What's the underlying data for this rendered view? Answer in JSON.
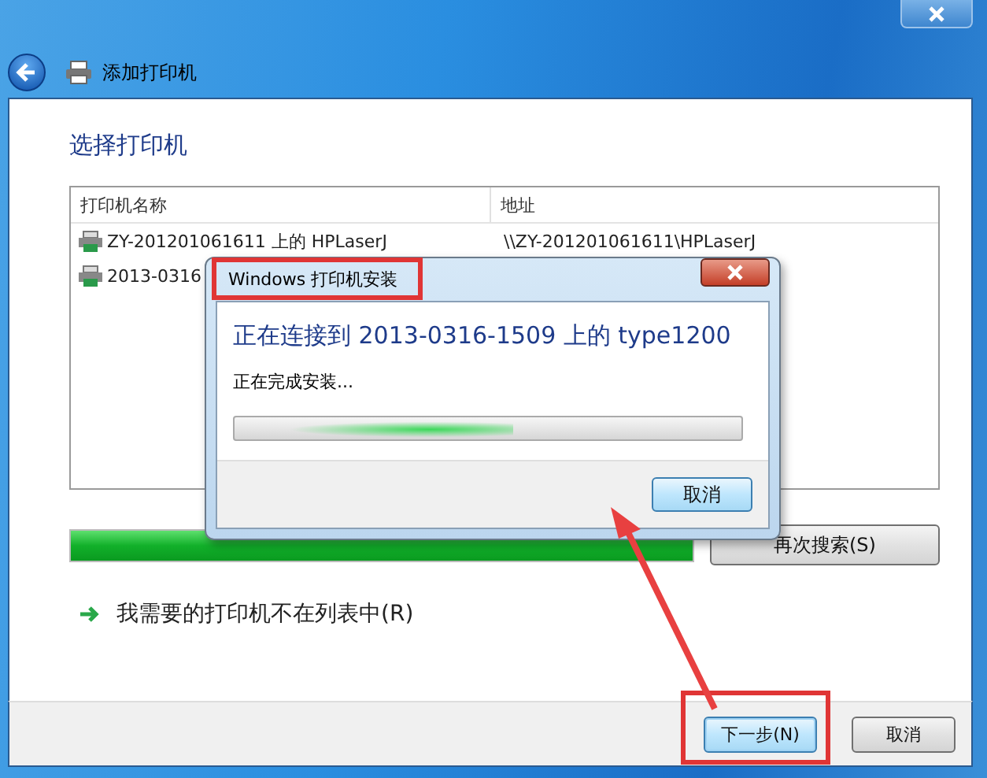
{
  "window": {
    "title": "添加打印机"
  },
  "heading": "选择打印机",
  "table": {
    "columns": [
      "打印机名称",
      "地址"
    ],
    "rows": [
      {
        "name": "ZY-201201061611 上的 HPLaserJ",
        "address": "\\\\ZY-201201061611\\HPLaserJ"
      },
      {
        "name": "2013-0316"
      }
    ]
  },
  "search_progress": {
    "level": 1
  },
  "search_again_button": "再次搜索(S)",
  "missing_printer_link": "我需要的打印机不在列表中(R)",
  "buttons": [
    {
      "label": "下一步(N)",
      "default": true
    },
    {
      "label": "取消",
      "default": false
    }
  ],
  "dialog": {
    "title": "Windows 打印机安装",
    "heading": "正在连接到 2013-0316-1509 上的 type1200",
    "status": "正在完成安装...",
    "progress": {
      "level": 0.55
    },
    "cancel_button": "取消"
  }
}
